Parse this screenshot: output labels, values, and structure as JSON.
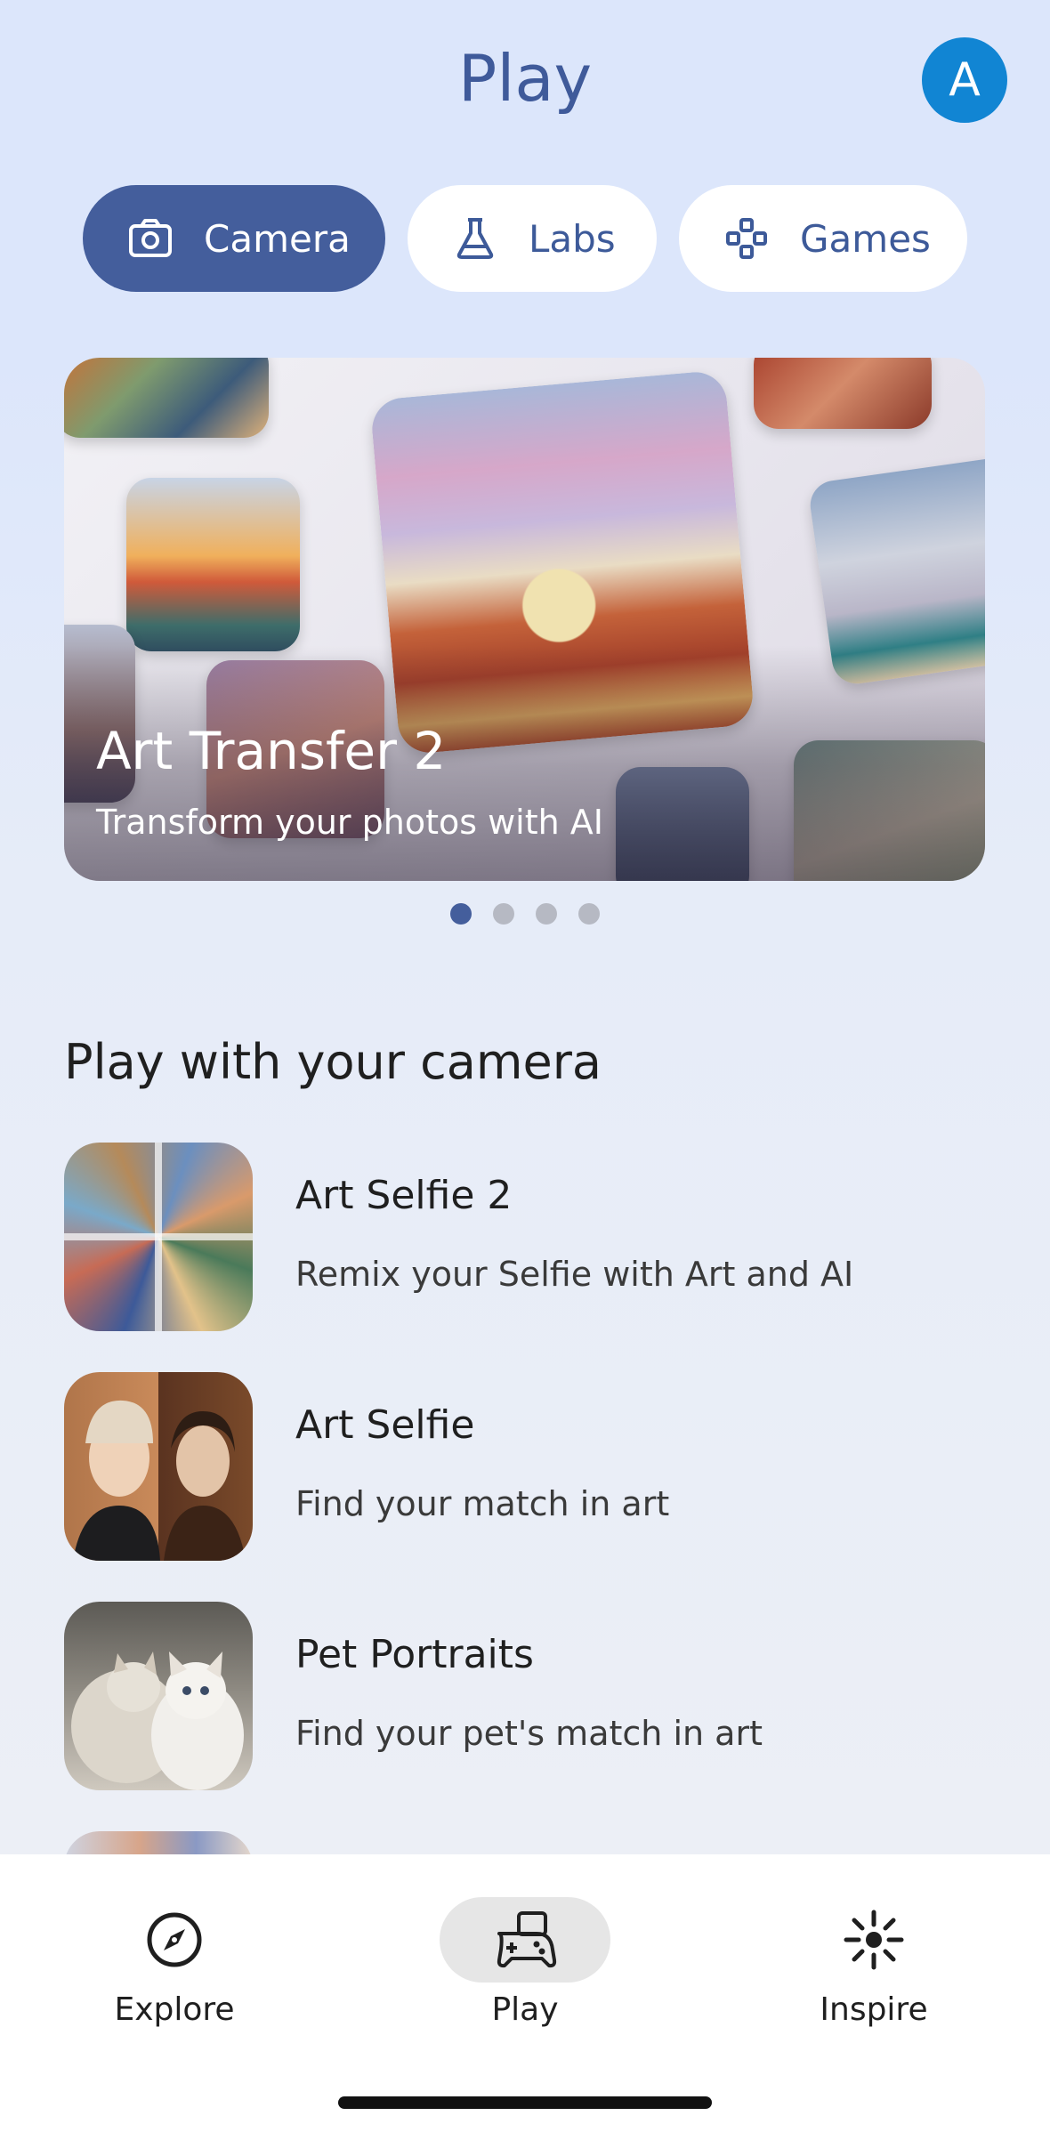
{
  "header": {
    "title": "Play",
    "avatar_initial": "A"
  },
  "tabs": [
    {
      "label": "Camera",
      "icon": "camera-icon",
      "selected": true
    },
    {
      "label": "Labs",
      "icon": "flask-icon",
      "selected": false
    },
    {
      "label": "Games",
      "icon": "gamepad-icon",
      "selected": false
    }
  ],
  "hero": {
    "title": "Art Transfer 2",
    "subtitle": "Transform your photos with AI",
    "page_count": 4,
    "active_page": 1
  },
  "section": {
    "title": "Play with your camera",
    "items": [
      {
        "title": "Art Selfie 2",
        "subtitle": "Remix your Selfie with Art and AI"
      },
      {
        "title": "Art Selfie",
        "subtitle": "Find your match in art"
      },
      {
        "title": "Pet Portraits",
        "subtitle": "Find your pet's match in art"
      }
    ]
  },
  "bottom_nav": [
    {
      "label": "Explore",
      "icon": "compass-icon",
      "selected": false
    },
    {
      "label": "Play",
      "icon": "game-controller-icon",
      "selected": true
    },
    {
      "label": "Inspire",
      "icon": "sparkle-icon",
      "selected": false
    }
  ],
  "colors": {
    "accent": "#445e9c",
    "title": "#3f5a9a",
    "avatar": "#1185d3",
    "background": "#dce6fb"
  }
}
